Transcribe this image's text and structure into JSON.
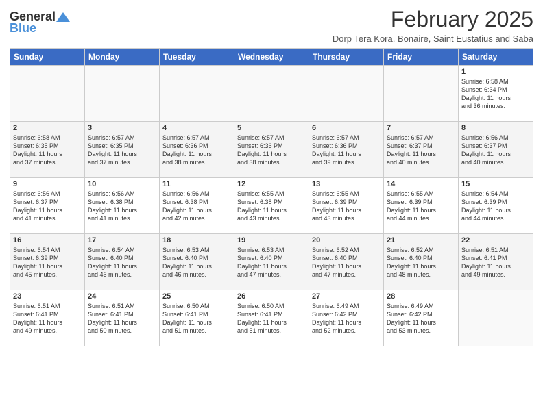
{
  "header": {
    "logo_general": "General",
    "logo_blue": "Blue",
    "month_title": "February 2025",
    "location": "Dorp Tera Kora, Bonaire, Saint Eustatius and Saba"
  },
  "weekdays": [
    "Sunday",
    "Monday",
    "Tuesday",
    "Wednesday",
    "Thursday",
    "Friday",
    "Saturday"
  ],
  "weeks": [
    [
      {
        "day": "",
        "info": ""
      },
      {
        "day": "",
        "info": ""
      },
      {
        "day": "",
        "info": ""
      },
      {
        "day": "",
        "info": ""
      },
      {
        "day": "",
        "info": ""
      },
      {
        "day": "",
        "info": ""
      },
      {
        "day": "1",
        "info": "Sunrise: 6:58 AM\nSunset: 6:34 PM\nDaylight: 11 hours\nand 36 minutes."
      }
    ],
    [
      {
        "day": "2",
        "info": "Sunrise: 6:58 AM\nSunset: 6:35 PM\nDaylight: 11 hours\nand 37 minutes."
      },
      {
        "day": "3",
        "info": "Sunrise: 6:57 AM\nSunset: 6:35 PM\nDaylight: 11 hours\nand 37 minutes."
      },
      {
        "day": "4",
        "info": "Sunrise: 6:57 AM\nSunset: 6:36 PM\nDaylight: 11 hours\nand 38 minutes."
      },
      {
        "day": "5",
        "info": "Sunrise: 6:57 AM\nSunset: 6:36 PM\nDaylight: 11 hours\nand 38 minutes."
      },
      {
        "day": "6",
        "info": "Sunrise: 6:57 AM\nSunset: 6:36 PM\nDaylight: 11 hours\nand 39 minutes."
      },
      {
        "day": "7",
        "info": "Sunrise: 6:57 AM\nSunset: 6:37 PM\nDaylight: 11 hours\nand 40 minutes."
      },
      {
        "day": "8",
        "info": "Sunrise: 6:56 AM\nSunset: 6:37 PM\nDaylight: 11 hours\nand 40 minutes."
      }
    ],
    [
      {
        "day": "9",
        "info": "Sunrise: 6:56 AM\nSunset: 6:37 PM\nDaylight: 11 hours\nand 41 minutes."
      },
      {
        "day": "10",
        "info": "Sunrise: 6:56 AM\nSunset: 6:38 PM\nDaylight: 11 hours\nand 41 minutes."
      },
      {
        "day": "11",
        "info": "Sunrise: 6:56 AM\nSunset: 6:38 PM\nDaylight: 11 hours\nand 42 minutes."
      },
      {
        "day": "12",
        "info": "Sunrise: 6:55 AM\nSunset: 6:38 PM\nDaylight: 11 hours\nand 43 minutes."
      },
      {
        "day": "13",
        "info": "Sunrise: 6:55 AM\nSunset: 6:39 PM\nDaylight: 11 hours\nand 43 minutes."
      },
      {
        "day": "14",
        "info": "Sunrise: 6:55 AM\nSunset: 6:39 PM\nDaylight: 11 hours\nand 44 minutes."
      },
      {
        "day": "15",
        "info": "Sunrise: 6:54 AM\nSunset: 6:39 PM\nDaylight: 11 hours\nand 44 minutes."
      }
    ],
    [
      {
        "day": "16",
        "info": "Sunrise: 6:54 AM\nSunset: 6:39 PM\nDaylight: 11 hours\nand 45 minutes."
      },
      {
        "day": "17",
        "info": "Sunrise: 6:54 AM\nSunset: 6:40 PM\nDaylight: 11 hours\nand 46 minutes."
      },
      {
        "day": "18",
        "info": "Sunrise: 6:53 AM\nSunset: 6:40 PM\nDaylight: 11 hours\nand 46 minutes."
      },
      {
        "day": "19",
        "info": "Sunrise: 6:53 AM\nSunset: 6:40 PM\nDaylight: 11 hours\nand 47 minutes."
      },
      {
        "day": "20",
        "info": "Sunrise: 6:52 AM\nSunset: 6:40 PM\nDaylight: 11 hours\nand 47 minutes."
      },
      {
        "day": "21",
        "info": "Sunrise: 6:52 AM\nSunset: 6:40 PM\nDaylight: 11 hours\nand 48 minutes."
      },
      {
        "day": "22",
        "info": "Sunrise: 6:51 AM\nSunset: 6:41 PM\nDaylight: 11 hours\nand 49 minutes."
      }
    ],
    [
      {
        "day": "23",
        "info": "Sunrise: 6:51 AM\nSunset: 6:41 PM\nDaylight: 11 hours\nand 49 minutes."
      },
      {
        "day": "24",
        "info": "Sunrise: 6:51 AM\nSunset: 6:41 PM\nDaylight: 11 hours\nand 50 minutes."
      },
      {
        "day": "25",
        "info": "Sunrise: 6:50 AM\nSunset: 6:41 PM\nDaylight: 11 hours\nand 51 minutes."
      },
      {
        "day": "26",
        "info": "Sunrise: 6:50 AM\nSunset: 6:41 PM\nDaylight: 11 hours\nand 51 minutes."
      },
      {
        "day": "27",
        "info": "Sunrise: 6:49 AM\nSunset: 6:42 PM\nDaylight: 11 hours\nand 52 minutes."
      },
      {
        "day": "28",
        "info": "Sunrise: 6:49 AM\nSunset: 6:42 PM\nDaylight: 11 hours\nand 53 minutes."
      },
      {
        "day": "",
        "info": ""
      }
    ]
  ]
}
